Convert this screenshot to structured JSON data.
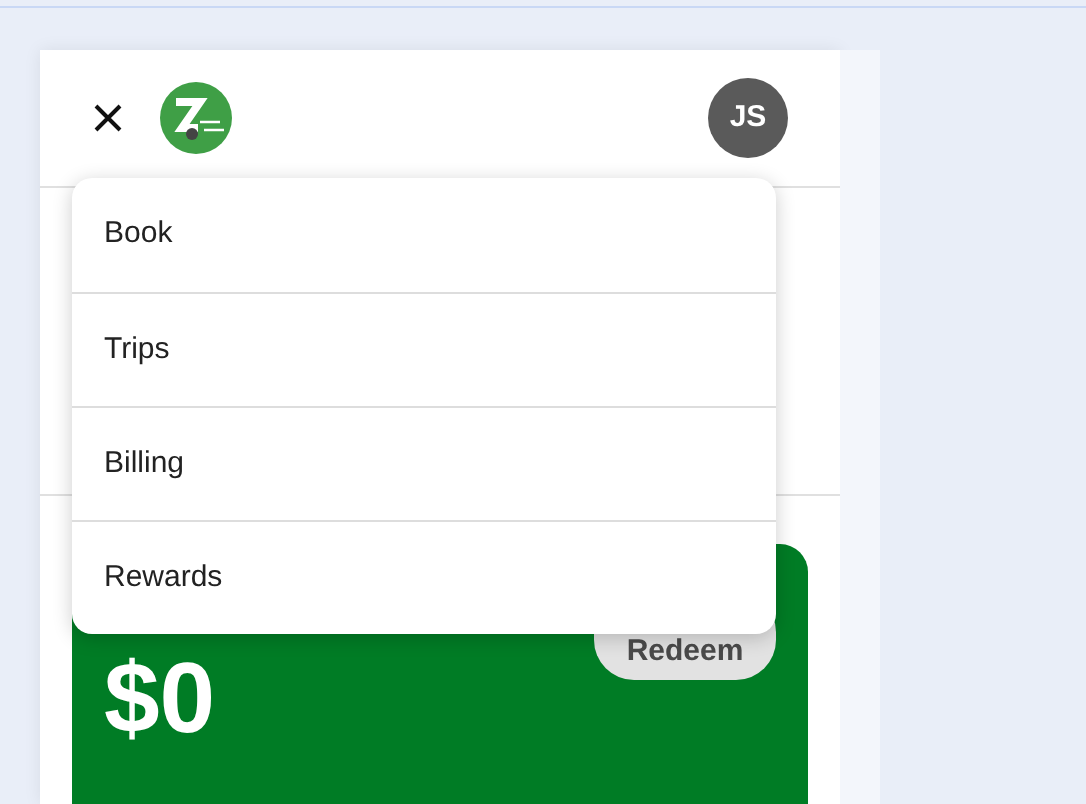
{
  "header": {
    "avatar_initials": "JS"
  },
  "menu": [
    {
      "label": "Book"
    },
    {
      "label": "Trips"
    },
    {
      "label": "Billing"
    },
    {
      "label": "Rewards"
    }
  ],
  "rewards_card": {
    "button": "Redeem",
    "amount": "$0"
  }
}
